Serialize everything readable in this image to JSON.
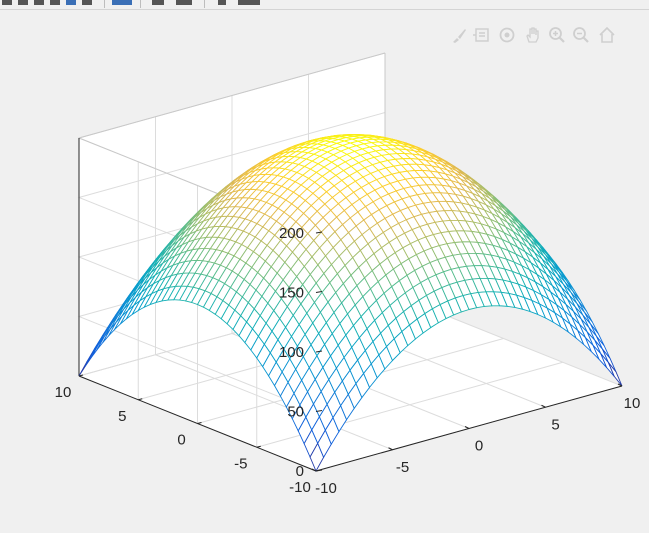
{
  "toolbar": {
    "icons": [
      "new-figure-icon",
      "open-file-icon",
      "save-icon",
      "print-icon",
      "link-icon",
      "insert-colorbar-icon",
      "insert-legend-icon",
      "edit-plot-icon",
      "property-inspector-icon"
    ]
  },
  "axes_toolbar": {
    "icons": [
      "brush-icon",
      "data-tips-icon",
      "rotate-3d-icon",
      "pan-icon",
      "zoom-in-icon",
      "zoom-out-icon",
      "home-icon"
    ]
  },
  "colormap": "parula",
  "chart_data": {
    "type": "surface",
    "function": "z = 200 - x^2 - y^2",
    "x_range": [
      -10,
      10
    ],
    "y_range": [
      -10,
      10
    ],
    "zlim": [
      0,
      200
    ],
    "x_ticks": [
      "-10",
      "-5",
      "0",
      "5",
      "10"
    ],
    "y_ticks": [
      "-10",
      "-5",
      "0",
      "5",
      "10"
    ],
    "z_ticks": [
      "0",
      "50",
      "100",
      "150",
      "200"
    ],
    "grid": true,
    "box": true,
    "view": "default 3-D"
  }
}
